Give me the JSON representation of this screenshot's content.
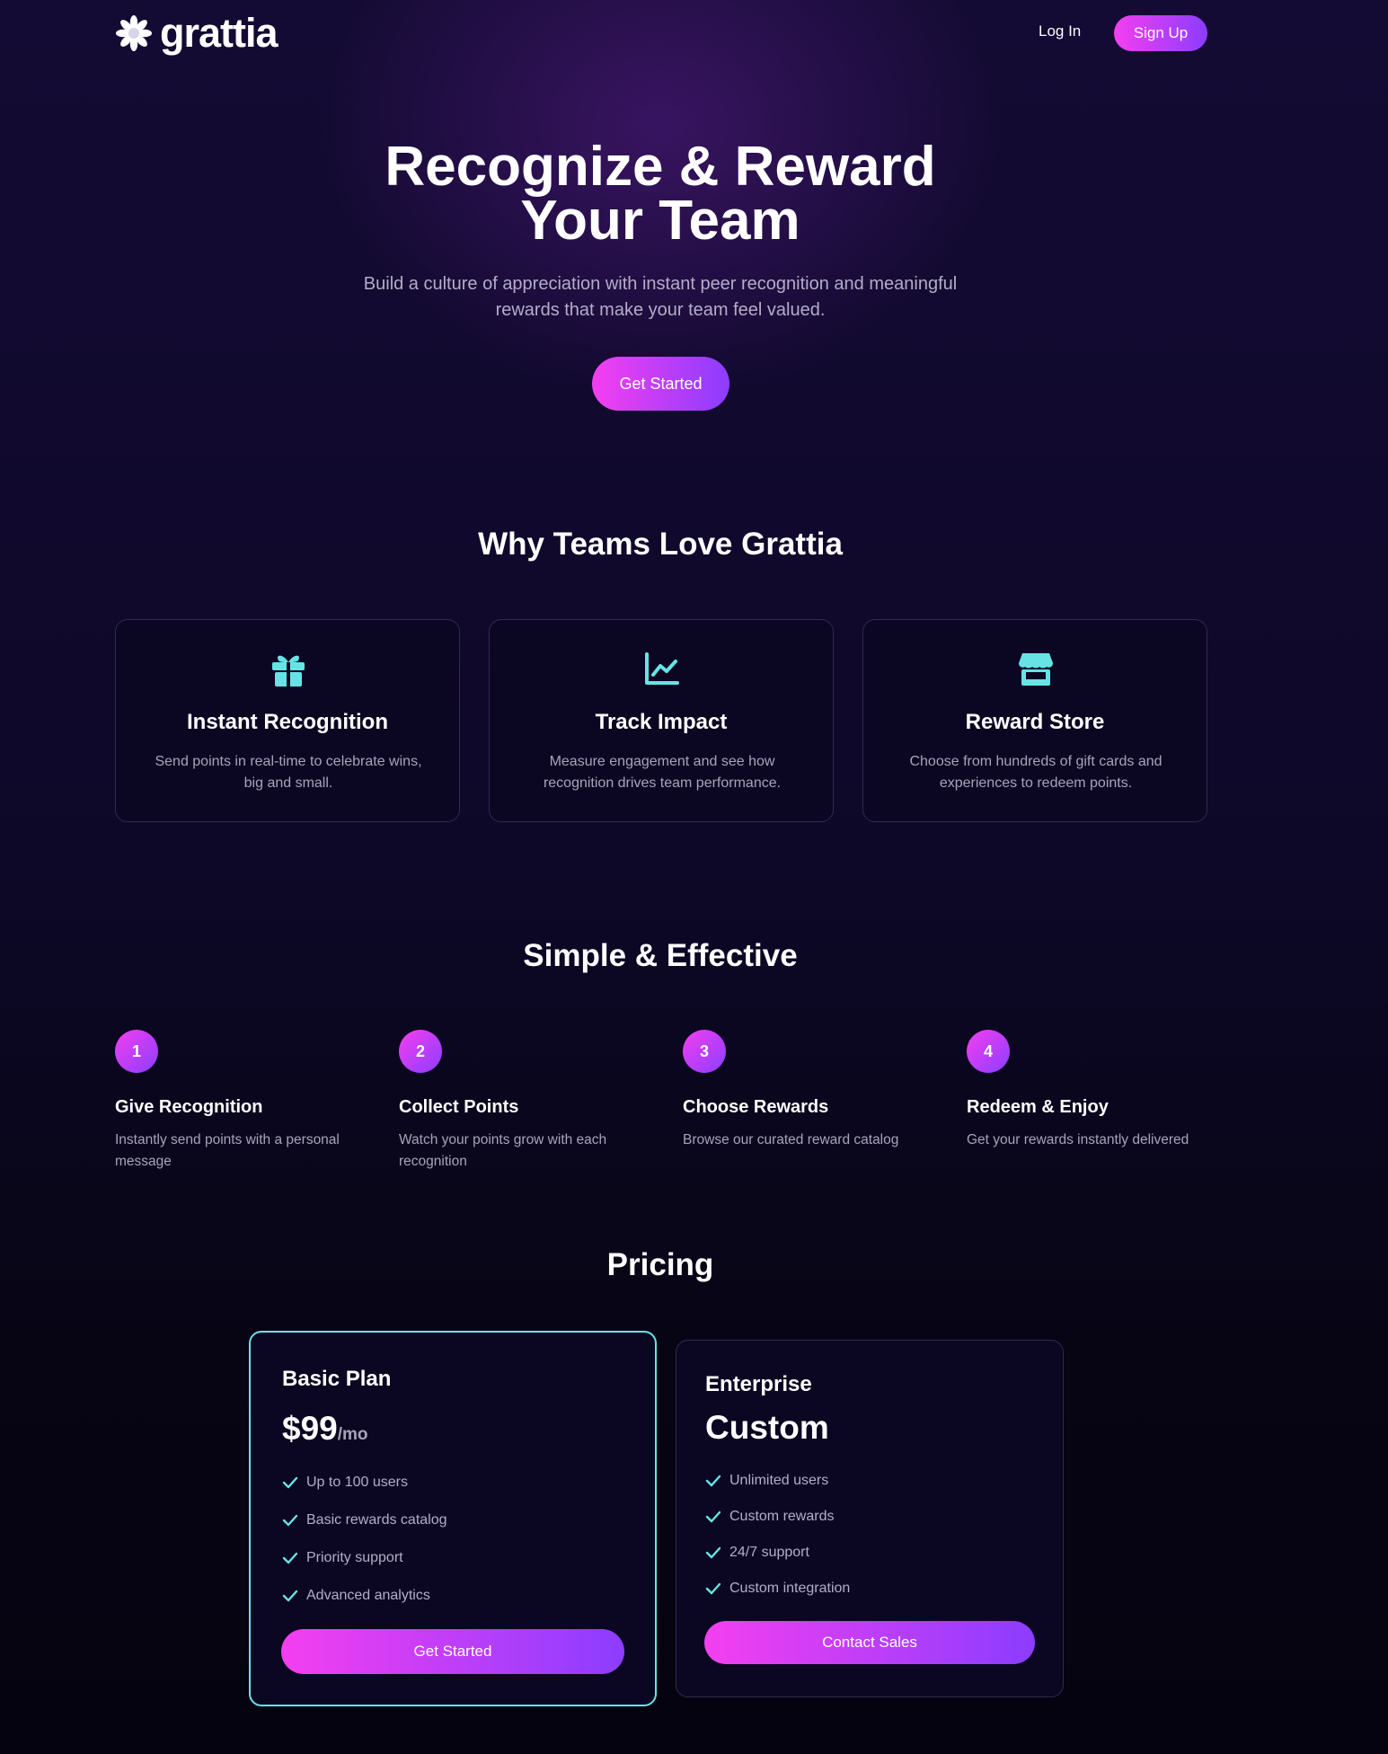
{
  "header": {
    "logo_text": "grattia",
    "login_label": "Log In",
    "signup_label": "Sign Up"
  },
  "hero": {
    "title_line1": "Recognize & Reward",
    "title_line2": "Your Team",
    "subtitle_line1": "Build a culture of appreciation with instant peer recognition and meaningful",
    "subtitle_line2": "rewards that make your team feel valued.",
    "cta_label": "Get Started"
  },
  "features": {
    "title": "Why Teams Love Grattia",
    "items": [
      {
        "icon": "gift-icon",
        "title": "Instant Recognition",
        "desc_line1": "Send points in real-time to celebrate wins,",
        "desc_line2": "big and small."
      },
      {
        "icon": "chart-line-icon",
        "title": "Track Impact",
        "desc_line1": "Measure engagement and see how",
        "desc_line2": "recognition drives team performance."
      },
      {
        "icon": "store-icon",
        "title": "Reward Store",
        "desc_line1": "Choose from hundreds of gift cards and",
        "desc_line2": "experiences to redeem points."
      }
    ]
  },
  "steps": {
    "title": "Simple & Effective",
    "items": [
      {
        "num": "1",
        "title": "Give Recognition",
        "desc_line1": "Instantly send points with a personal",
        "desc_line2": "message"
      },
      {
        "num": "2",
        "title": "Collect Points",
        "desc_line1": "Watch your points grow with each",
        "desc_line2": "recognition"
      },
      {
        "num": "3",
        "title": "Choose Rewards",
        "desc_line1": "Browse our curated reward catalog",
        "desc_line2": ""
      },
      {
        "num": "4",
        "title": "Redeem & Enjoy",
        "desc_line1": "Get your rewards instantly delivered",
        "desc_line2": ""
      }
    ]
  },
  "pricing": {
    "title": "Pricing",
    "basic": {
      "name": "Basic Plan",
      "price": "$99",
      "period": "/mo",
      "features": [
        "Up to 100 users",
        "Basic rewards catalog",
        "Priority support",
        "Advanced analytics"
      ],
      "cta_label": "Get Started"
    },
    "enterprise": {
      "name": "Enterprise",
      "price": "Custom",
      "features": [
        "Unlimited users",
        "Custom rewards",
        "24/7 support",
        "Custom integration"
      ],
      "cta_label": "Contact Sales"
    }
  },
  "colors": {
    "accent_pink": "#f43ff0",
    "accent_purple": "#8b3dff",
    "icon_cyan": "#67e3e6",
    "background": "#0b0720"
  }
}
